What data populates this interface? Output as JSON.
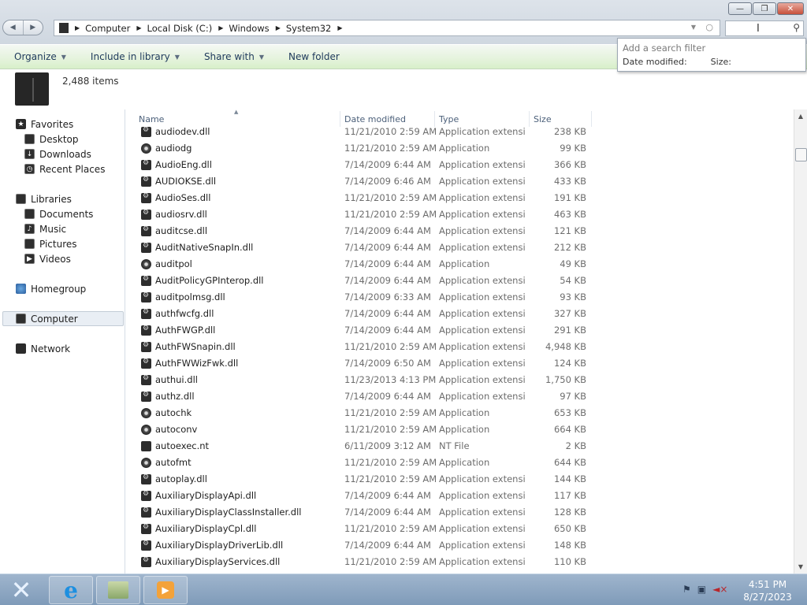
{
  "window": {
    "minimize_label": "—",
    "maximize_label": "❐",
    "close_label": "✕"
  },
  "address": {
    "crumbs": [
      "Computer",
      "Local Disk (C:)",
      "Windows",
      "System32"
    ]
  },
  "toolbar": {
    "organize": "Organize",
    "include": "Include in library",
    "share": "Share with",
    "new_folder": "New folder"
  },
  "search_filter": {
    "title": "Add a search filter",
    "opt1": "Date modified:",
    "opt2": "Size:"
  },
  "details": {
    "count": "2,488 items"
  },
  "nav": {
    "favorites": "Favorites",
    "desktop": "Desktop",
    "downloads": "Downloads",
    "recent": "Recent Places",
    "libraries": "Libraries",
    "documents": "Documents",
    "music": "Music",
    "pictures": "Pictures",
    "videos": "Videos",
    "homegroup": "Homegroup",
    "computer": "Computer",
    "network": "Network"
  },
  "columns": {
    "name": "Name",
    "date": "Date modified",
    "type": "Type",
    "size": "Size"
  },
  "files": [
    {
      "name": "audiodev.dll",
      "date": "11/21/2010 2:59 AM",
      "type": "Application extensi...",
      "size": "238 KB",
      "icon": "dll"
    },
    {
      "name": "audiodg",
      "date": "11/21/2010 2:59 AM",
      "type": "Application",
      "size": "99 KB",
      "icon": "app"
    },
    {
      "name": "AudioEng.dll",
      "date": "7/14/2009 6:44 AM",
      "type": "Application extensi...",
      "size": "366 KB",
      "icon": "dll"
    },
    {
      "name": "AUDIOKSE.dll",
      "date": "7/14/2009 6:46 AM",
      "type": "Application extensi...",
      "size": "433 KB",
      "icon": "dll"
    },
    {
      "name": "AudioSes.dll",
      "date": "11/21/2010 2:59 AM",
      "type": "Application extensi...",
      "size": "191 KB",
      "icon": "dll"
    },
    {
      "name": "audiosrv.dll",
      "date": "11/21/2010 2:59 AM",
      "type": "Application extensi...",
      "size": "463 KB",
      "icon": "dll"
    },
    {
      "name": "auditcse.dll",
      "date": "7/14/2009 6:44 AM",
      "type": "Application extensi...",
      "size": "121 KB",
      "icon": "dll"
    },
    {
      "name": "AuditNativeSnapIn.dll",
      "date": "7/14/2009 6:44 AM",
      "type": "Application extensi...",
      "size": "212 KB",
      "icon": "dll"
    },
    {
      "name": "auditpol",
      "date": "7/14/2009 6:44 AM",
      "type": "Application",
      "size": "49 KB",
      "icon": "app"
    },
    {
      "name": "AuditPolicyGPInterop.dll",
      "date": "7/14/2009 6:44 AM",
      "type": "Application extensi...",
      "size": "54 KB",
      "icon": "dll"
    },
    {
      "name": "auditpolmsg.dll",
      "date": "7/14/2009 6:33 AM",
      "type": "Application extensi...",
      "size": "93 KB",
      "icon": "dll"
    },
    {
      "name": "authfwcfg.dll",
      "date": "7/14/2009 6:44 AM",
      "type": "Application extensi...",
      "size": "327 KB",
      "icon": "dll"
    },
    {
      "name": "AuthFWGP.dll",
      "date": "7/14/2009 6:44 AM",
      "type": "Application extensi...",
      "size": "291 KB",
      "icon": "dll"
    },
    {
      "name": "AuthFWSnapin.dll",
      "date": "11/21/2010 2:59 AM",
      "type": "Application extensi...",
      "size": "4,948 KB",
      "icon": "dll"
    },
    {
      "name": "AuthFWWizFwk.dll",
      "date": "7/14/2009 6:50 AM",
      "type": "Application extensi...",
      "size": "124 KB",
      "icon": "dll"
    },
    {
      "name": "authui.dll",
      "date": "11/23/2013 4:13 PM",
      "type": "Application extensi...",
      "size": "1,750 KB",
      "icon": "dll"
    },
    {
      "name": "authz.dll",
      "date": "7/14/2009 6:44 AM",
      "type": "Application extensi...",
      "size": "97 KB",
      "icon": "dll"
    },
    {
      "name": "autochk",
      "date": "11/21/2010 2:59 AM",
      "type": "Application",
      "size": "653 KB",
      "icon": "app"
    },
    {
      "name": "autoconv",
      "date": "11/21/2010 2:59 AM",
      "type": "Application",
      "size": "664 KB",
      "icon": "app"
    },
    {
      "name": "autoexec.nt",
      "date": "6/11/2009 3:12 AM",
      "type": "NT File",
      "size": "2 KB",
      "icon": "file"
    },
    {
      "name": "autofmt",
      "date": "11/21/2010 2:59 AM",
      "type": "Application",
      "size": "644 KB",
      "icon": "app"
    },
    {
      "name": "autoplay.dll",
      "date": "11/21/2010 2:59 AM",
      "type": "Application extensi...",
      "size": "144 KB",
      "icon": "dll"
    },
    {
      "name": "AuxiliaryDisplayApi.dll",
      "date": "7/14/2009 6:44 AM",
      "type": "Application extensi...",
      "size": "117 KB",
      "icon": "dll"
    },
    {
      "name": "AuxiliaryDisplayClassInstaller.dll",
      "date": "7/14/2009 6:44 AM",
      "type": "Application extensi...",
      "size": "128 KB",
      "icon": "dll"
    },
    {
      "name": "AuxiliaryDisplayCpl.dll",
      "date": "11/21/2010 2:59 AM",
      "type": "Application extensi...",
      "size": "650 KB",
      "icon": "dll"
    },
    {
      "name": "AuxiliaryDisplayDriverLib.dll",
      "date": "7/14/2009 6:44 AM",
      "type": "Application extensi...",
      "size": "148 KB",
      "icon": "dll"
    },
    {
      "name": "AuxiliaryDisplayServices.dll",
      "date": "11/21/2010 2:59 AM",
      "type": "Application extensi...",
      "size": "110 KB",
      "icon": "dll"
    }
  ],
  "taskbar": {
    "time": "4:51 PM",
    "date": "8/27/2023"
  }
}
